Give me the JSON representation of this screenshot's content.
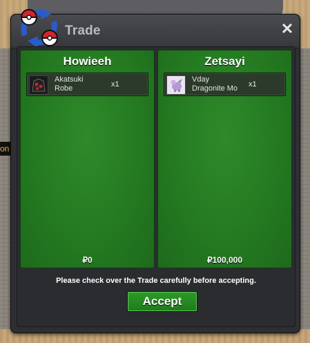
{
  "window": {
    "title": "Trade",
    "close_glyph": "✕"
  },
  "background": {
    "side_text": "on"
  },
  "left_trader": {
    "name": "Howieeh",
    "items": [
      {
        "name_line1": "Akatsuki",
        "name_line2": "Robe",
        "qty": "x1",
        "icon": "robe-icon"
      }
    ],
    "money": "₽0"
  },
  "right_trader": {
    "name": "Zetsayi",
    "items": [
      {
        "name_line1": "Vday",
        "name_line2": "Dragonite Mo",
        "qty": "x1",
        "icon": "dragonite-mount-icon"
      }
    ],
    "money": "₽100,000"
  },
  "notice": "Please check over the Trade carefully before accepting.",
  "accept_label": "Accept",
  "colors": {
    "panel_green": "#247a21",
    "button_green": "#2e9a2a",
    "window_dark": "#2e2f33"
  }
}
